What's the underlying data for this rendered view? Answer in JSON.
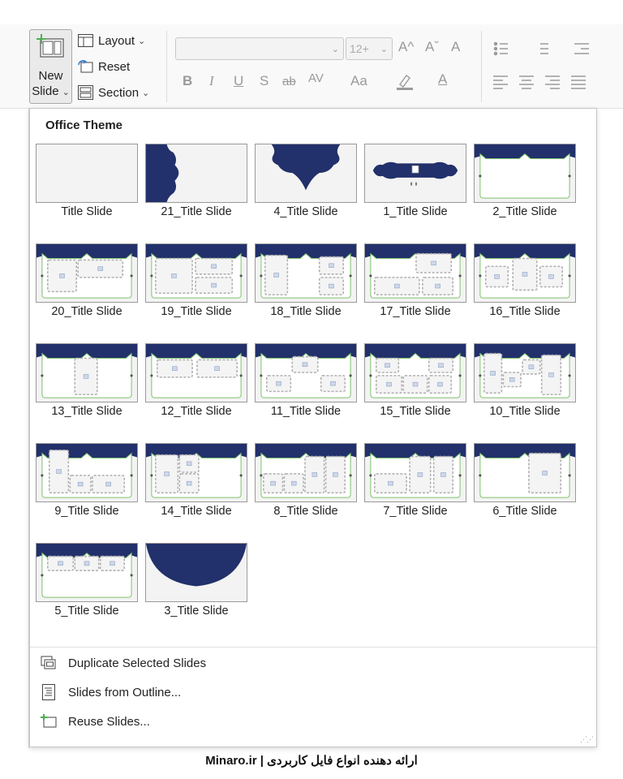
{
  "ribbon": {
    "new_slide": {
      "line1": "New",
      "line2": "Slide",
      "chevron": "⌄",
      "icon": "new-slide-icon"
    },
    "layout_label": "Layout",
    "reset_label": "Reset",
    "section_label": "Section",
    "font_name_value": "",
    "font_size_value": "12+",
    "format_glyphs": {
      "grow": "A^",
      "shrink": "Aˇ",
      "clear": "A",
      "bold": "B",
      "italic": "I",
      "underline": "U",
      "shadow": "S",
      "strike": "ab",
      "spacing": "AV",
      "case": "Aa",
      "font_color": "A"
    }
  },
  "gallery": {
    "title": "Office Theme",
    "layouts": [
      {
        "label": "Title Slide",
        "type": "blank"
      },
      {
        "label": "21_Title Slide",
        "type": "left-shape"
      },
      {
        "label": "4_Title Slide",
        "type": "top-shape"
      },
      {
        "label": "1_Title Slide",
        "type": "banner"
      },
      {
        "label": "2_Title Slide",
        "type": "frame-empty"
      },
      {
        "label": "20_Title Slide",
        "type": "frame-2col"
      },
      {
        "label": "19_Title Slide",
        "type": "frame-1plus2"
      },
      {
        "label": "18_Title Slide",
        "type": "frame-tall-2stack"
      },
      {
        "label": "17_Title Slide",
        "type": "frame-4grid"
      },
      {
        "label": "16_Title Slide",
        "type": "frame-3col"
      },
      {
        "label": "13_Title Slide",
        "type": "frame-center-tall"
      },
      {
        "label": "12_Title Slide",
        "type": "frame-2top"
      },
      {
        "label": "11_Title Slide",
        "type": "frame-3stagger"
      },
      {
        "label": "15_Title Slide",
        "type": "frame-mosaic"
      },
      {
        "label": "10_Title Slide",
        "type": "frame-10"
      },
      {
        "label": "9_Title Slide",
        "type": "frame-9"
      },
      {
        "label": "14_Title Slide",
        "type": "frame-14"
      },
      {
        "label": "8_Title Slide",
        "type": "frame-8"
      },
      {
        "label": "7_Title Slide",
        "type": "frame-7"
      },
      {
        "label": "6_Title Slide",
        "type": "frame-6"
      },
      {
        "label": "5_Title Slide",
        "type": "frame-5"
      },
      {
        "label": "3_Title Slide",
        "type": "arc"
      }
    ]
  },
  "menu": {
    "duplicate": "Duplicate Selected Slides",
    "outline": "Slides from Outline...",
    "reuse": "Reuse Slides..."
  },
  "footer": "Minaro.ir | ارائه دهنده انواع فایل کاربردی",
  "colors": {
    "navy": "#22306b",
    "frame_green": "#7cc36a",
    "placeholder": "#b0b0b0"
  }
}
